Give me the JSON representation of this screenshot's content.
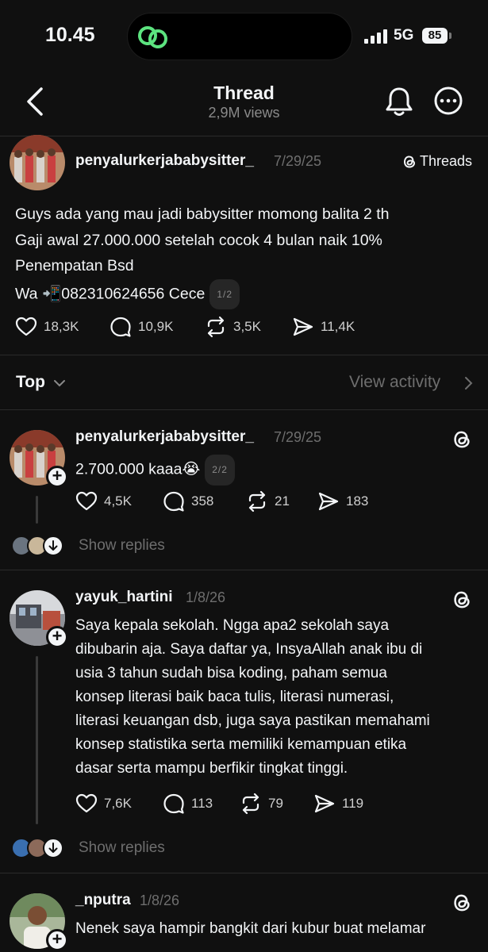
{
  "status_bar": {
    "time": "10.45",
    "network": "5G",
    "battery": "85"
  },
  "header": {
    "title": "Thread",
    "subtitle": "2,9M views"
  },
  "original_post": {
    "username": "penyalurkerjababysitter_",
    "date": "7/29/25",
    "badge": "Threads",
    "lines": [
      "Guys ada yang mau jadi babysitter momong balita 2 th",
      "Gaji awal 27.000.000 setelah cocok 4 bulan naik 10%",
      "Penempatan Bsd",
      "Wa 📲082310624656 Cece"
    ],
    "page_pill": "1/2",
    "likes": "18,3K",
    "comments": "10,9K",
    "reposts": "3,5K",
    "shares": "11,4K"
  },
  "sort": {
    "label": "Top",
    "view_activity": "View activity"
  },
  "replies": [
    {
      "username": "penyalurkerjababysitter_",
      "date": "7/29/25",
      "text": "2.700.000 kaaa😭",
      "page_pill": "2/2",
      "likes": "4,5K",
      "comments": "358",
      "reposts": "21",
      "shares": "183",
      "show_replies": "Show replies"
    },
    {
      "username": "yayuk_hartini",
      "date": "1/8/26",
      "lines": [
        "Saya kepala sekolah. Ngga apa2 sekolah saya",
        "dibubarin aja. Saya daftar ya, InsyaAllah anak ibu di",
        "usia 3 tahun sudah bisa koding, paham semua",
        "konsep literasi baik baca tulis, literasi numerasi,",
        "literasi keuangan dsb, juga saya pastikan memahami",
        "konsep statistika serta memiliki kemampuan etika",
        "dasar serta mampu berfikir tingkat tinggi."
      ],
      "likes": "7,6K",
      "comments": "113",
      "reposts": "79",
      "shares": "119",
      "show_replies": "Show replies"
    },
    {
      "username": "_nputra",
      "date": "1/8/26",
      "text": "Nenek saya hampir bangkit dari kubur buat melamar"
    }
  ],
  "icons": [
    "threads-logo-icon",
    "back-chevron-icon",
    "bell-icon",
    "more-icon",
    "heart-icon",
    "comment-icon",
    "repost-icon",
    "share-icon",
    "follow-plus-icon"
  ],
  "colors": {
    "background": "#101010",
    "text": "#f3f5f7",
    "muted": "#6e6e6e",
    "divider": "#2b2b2b",
    "link_green": "#5ce37f"
  }
}
